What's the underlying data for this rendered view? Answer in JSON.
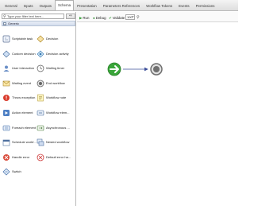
{
  "tabs": [
    {
      "label": "General",
      "active": false
    },
    {
      "label": "Inputs",
      "active": false
    },
    {
      "label": "Outputs",
      "active": false
    },
    {
      "label": "Schema",
      "active": true
    },
    {
      "label": "Presentation",
      "active": false
    },
    {
      "label": "Parameters References",
      "active": false
    },
    {
      "label": "Workflow Tokens",
      "active": false
    },
    {
      "label": "Events",
      "active": false
    },
    {
      "label": "Permissions",
      "active": false
    }
  ],
  "palette": {
    "search_placeholder": "Type your filter text here...",
    "search_button": "⇨",
    "group_label": "Generic",
    "group_toggle": "−",
    "items": [
      {
        "label": "Scriptable task",
        "icon": "scriptable-task-icon"
      },
      {
        "label": "Decision",
        "icon": "decision-icon"
      },
      {
        "label": "Custom decision",
        "icon": "custom-decision-icon"
      },
      {
        "label": "Decision activity",
        "icon": "decision-activity-icon"
      },
      {
        "label": "User interaction",
        "icon": "user-interaction-icon"
      },
      {
        "label": "Waiting timer",
        "icon": "waiting-timer-icon"
      },
      {
        "label": "Waiting event",
        "icon": "waiting-event-icon"
      },
      {
        "label": "End workflow",
        "icon": "end-workflow-icon"
      },
      {
        "label": "Throw exception",
        "icon": "throw-exception-icon"
      },
      {
        "label": "Workflow note",
        "icon": "workflow-note-icon"
      },
      {
        "label": "Action element",
        "icon": "action-element-icon"
      },
      {
        "label": "Workflow elem...",
        "icon": "workflow-element-icon"
      },
      {
        "label": "Foreach element",
        "icon": "foreach-element-icon"
      },
      {
        "label": "Asynchronous ...",
        "icon": "asynchronous-workflow-icon"
      },
      {
        "label": "Schedule workf...",
        "icon": "schedule-workflow-icon"
      },
      {
        "label": "Nested workflow",
        "icon": "nested-workflow-icon"
      },
      {
        "label": "Handle error",
        "icon": "handle-error-icon"
      },
      {
        "label": "Default error ha...",
        "icon": "default-error-handler-icon"
      },
      {
        "label": "Switch",
        "icon": "switch-icon"
      }
    ]
  },
  "toolbar": {
    "run": "Run",
    "debug": "Debug",
    "validate": "Validate",
    "zoom": "100",
    "zoom_icon": "zoom-icon"
  },
  "canvas": {
    "start_node": "start-node-icon",
    "end_node": "end-node-icon"
  },
  "colors": {
    "start": "#3aa63a",
    "end": "#6f6f6f",
    "link": "#3d4f9a"
  }
}
